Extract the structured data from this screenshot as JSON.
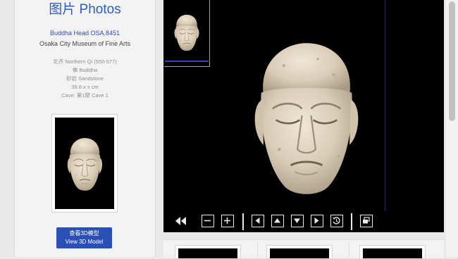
{
  "header": {
    "title": "图片 Photos"
  },
  "object": {
    "title": "Buddha Head OSA.8451",
    "museum": "Osaka City Museum of Fine Arts",
    "details": [
      "北齐 Northern Qi (550-577)",
      "佛 Buddha",
      "砂岩 Sandstone",
      "39.8 x x cm",
      "Cave: 第1窟 Cave 1"
    ]
  },
  "actions": {
    "view3d_cn": "查看3D模型",
    "view3d_en": "View 3D Model"
  },
  "viewer": {
    "image_icon": "buddha-head-photo",
    "toolbar": [
      {
        "name": "rewind-button",
        "icon": "double-left-arrow-icon"
      },
      {
        "name": "zoom-out-button",
        "icon": "minus-icon"
      },
      {
        "name": "zoom-in-button",
        "icon": "plus-icon"
      },
      {
        "name": "pan-left-button",
        "icon": "triangle-left-icon"
      },
      {
        "name": "pan-up-button",
        "icon": "triangle-up-icon"
      },
      {
        "name": "pan-down-button",
        "icon": "triangle-down-icon"
      },
      {
        "name": "pan-right-button",
        "icon": "triangle-right-icon"
      },
      {
        "name": "reset-button",
        "icon": "rotate-reset-icon"
      },
      {
        "name": "fullscreen-button",
        "icon": "windows-stack-icon"
      }
    ]
  },
  "colors": {
    "accent": "#2c5cc5",
    "button_bg": "#2a50b6",
    "viewer_bg": "#000000",
    "toolbar_icon": "#e8e8e8"
  }
}
